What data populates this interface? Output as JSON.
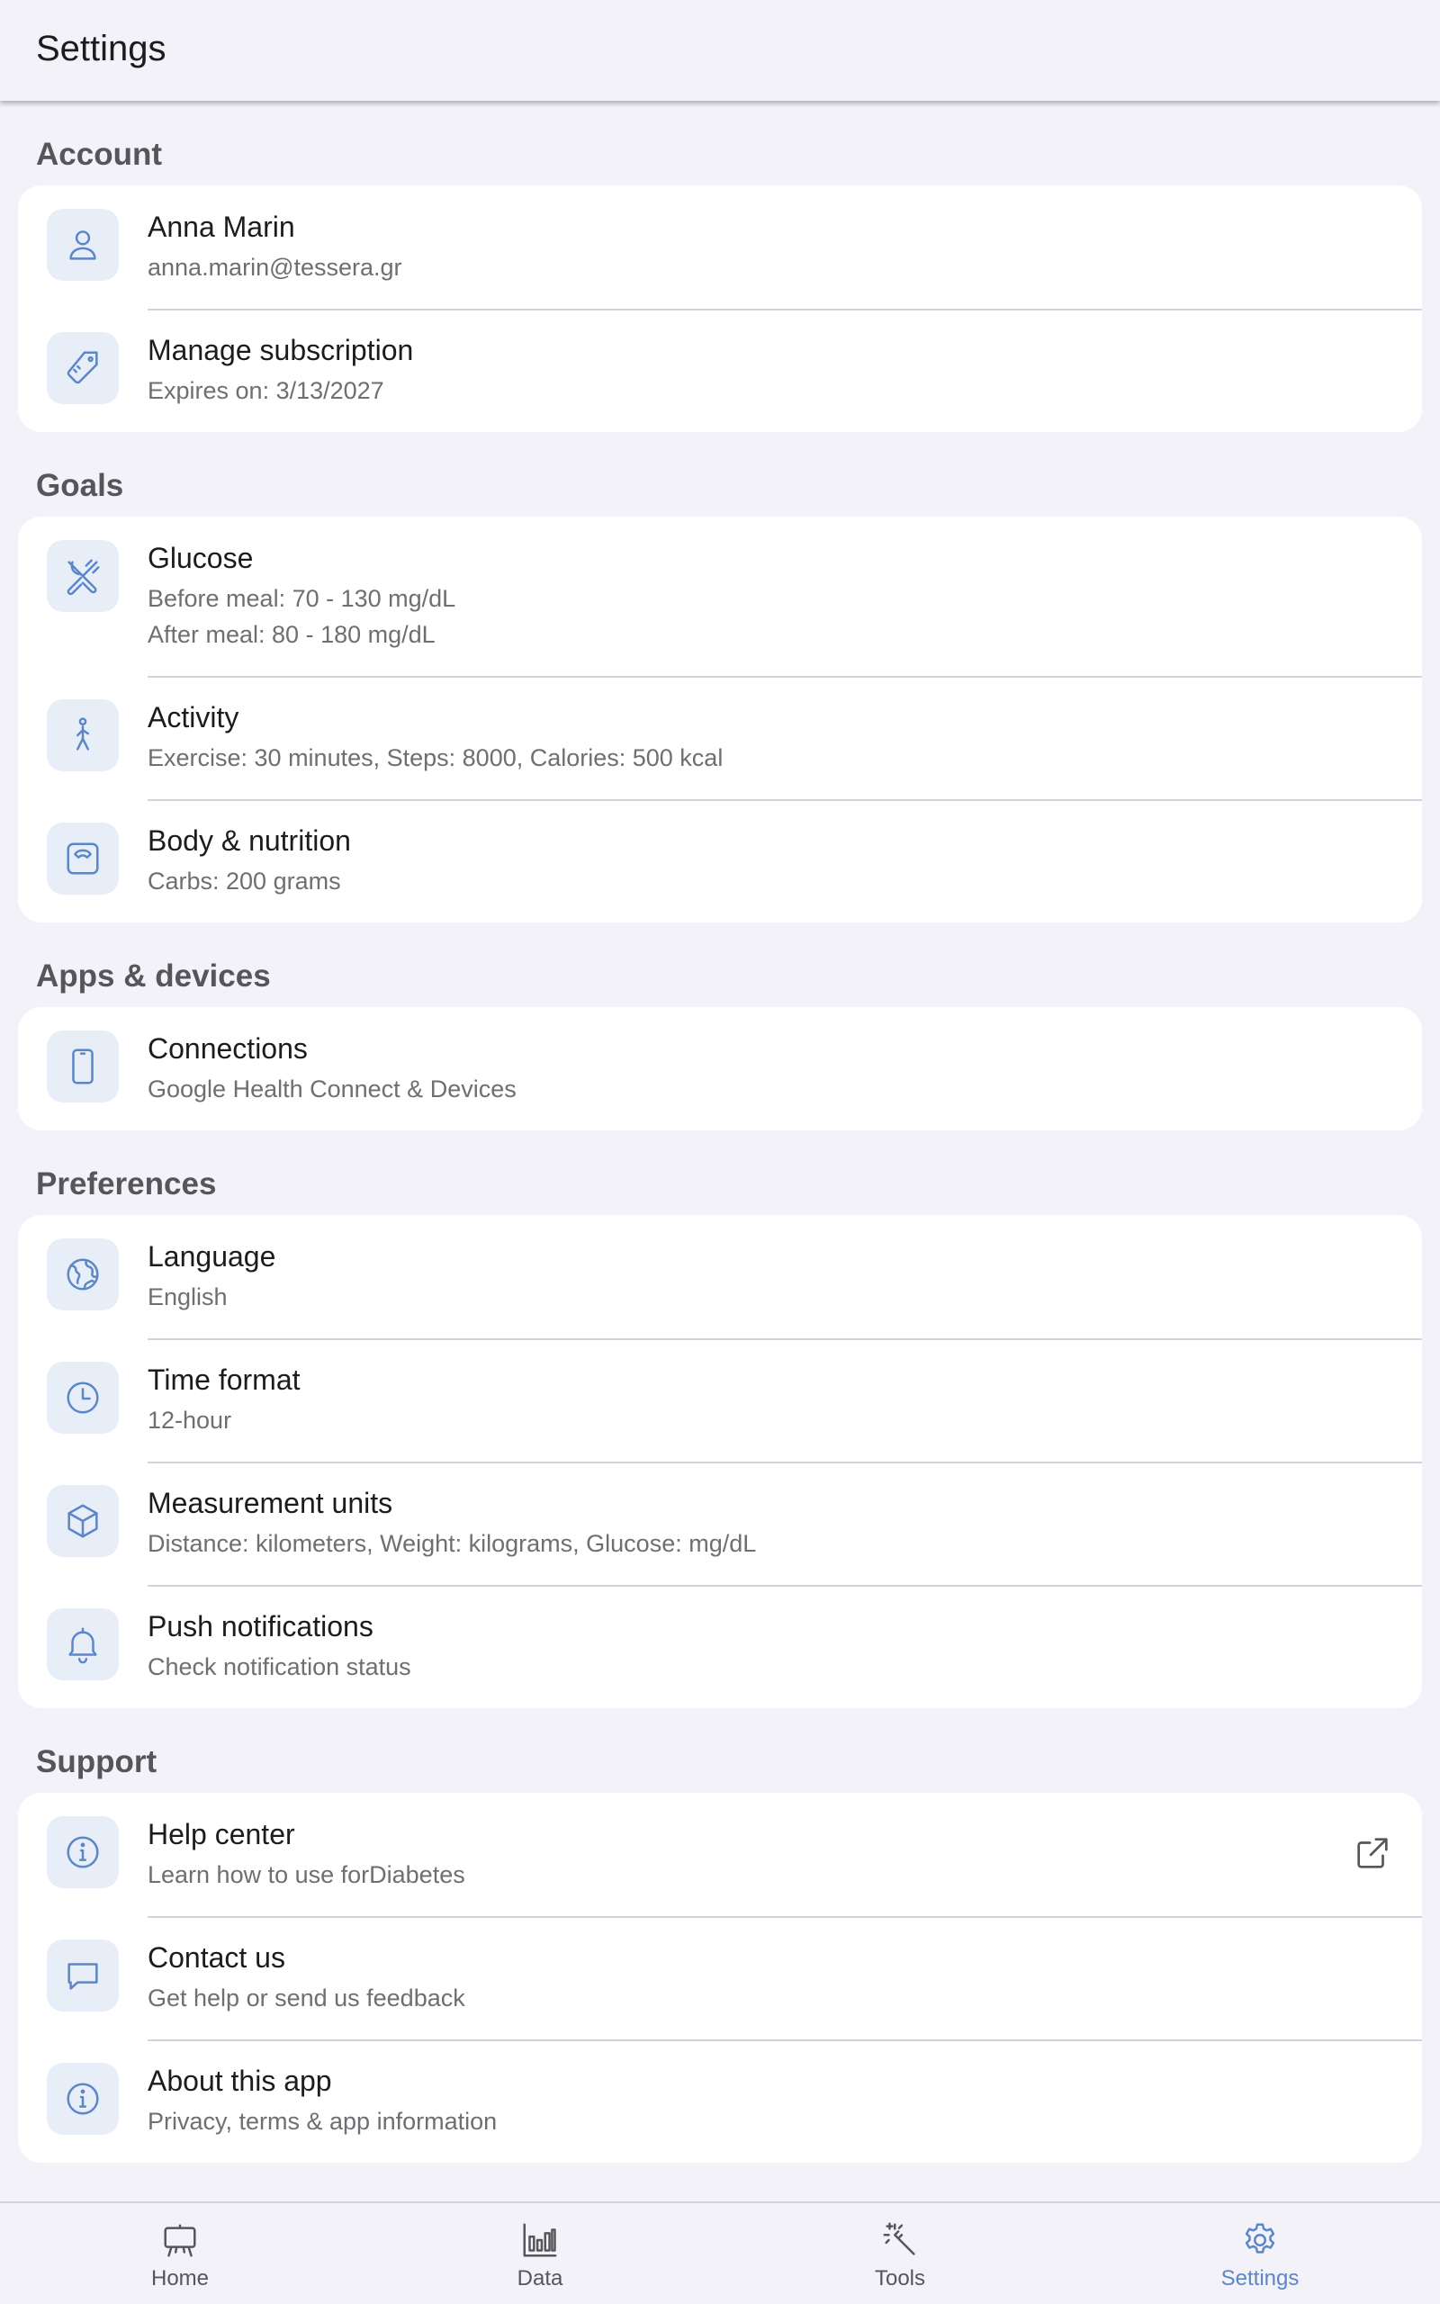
{
  "appbar": {
    "title": "Settings"
  },
  "colors": {
    "accent": "#5b86c8",
    "icon_bg": "#e8eef8",
    "background": "#f2f2f8"
  },
  "sections": {
    "account": {
      "title": "Account",
      "items": [
        {
          "icon": "person-icon",
          "title": "Anna Marin",
          "subtitle": "anna.marin@tessera.gr"
        },
        {
          "icon": "tag-icon",
          "title": "Manage subscription",
          "subtitle": "Expires on: 3/13/2027"
        }
      ]
    },
    "goals": {
      "title": "Goals",
      "items": [
        {
          "icon": "utensils-icon",
          "title": "Glucose",
          "subtitle": "Before meal: 70 - 130 mg/dL",
          "subtitle2": "After meal: 80 - 180 mg/dL"
        },
        {
          "icon": "walking-icon",
          "title": "Activity",
          "subtitle": "Exercise: 30 minutes, Steps: 8000, Calories: 500 kcal"
        },
        {
          "icon": "scale-icon",
          "title": "Body & nutrition",
          "subtitle": "Carbs: 200 grams"
        }
      ]
    },
    "apps": {
      "title": "Apps & devices",
      "items": [
        {
          "icon": "phone-icon",
          "title": "Connections",
          "subtitle": "Google Health Connect & Devices"
        }
      ]
    },
    "preferences": {
      "title": "Preferences",
      "items": [
        {
          "icon": "globe-icon",
          "title": "Language",
          "subtitle": "English"
        },
        {
          "icon": "clock-icon",
          "title": "Time format",
          "subtitle": "12-hour"
        },
        {
          "icon": "cube-icon",
          "title": "Measurement units",
          "subtitle": "Distance: kilometers, Weight: kilograms, Glucose: mg/dL"
        },
        {
          "icon": "bell-icon",
          "title": "Push notifications",
          "subtitle": "Check notification status"
        }
      ]
    },
    "support": {
      "title": "Support",
      "items": [
        {
          "icon": "info-icon",
          "title": "Help center",
          "subtitle": "Learn how to use forDiabetes",
          "trailing": "external-link-icon"
        },
        {
          "icon": "chat-bubble-icon",
          "title": "Contact us",
          "subtitle": "Get help or send us feedback"
        },
        {
          "icon": "info-icon",
          "title": "About this app",
          "subtitle": "Privacy, terms & app information"
        }
      ]
    }
  },
  "bottom_nav": {
    "items": [
      {
        "icon": "presentation-board-icon",
        "label": "Home",
        "active": false
      },
      {
        "icon": "bar-chart-icon",
        "label": "Data",
        "active": false
      },
      {
        "icon": "magic-wand-icon",
        "label": "Tools",
        "active": false
      },
      {
        "icon": "gear-icon",
        "label": "Settings",
        "active": true
      }
    ]
  }
}
